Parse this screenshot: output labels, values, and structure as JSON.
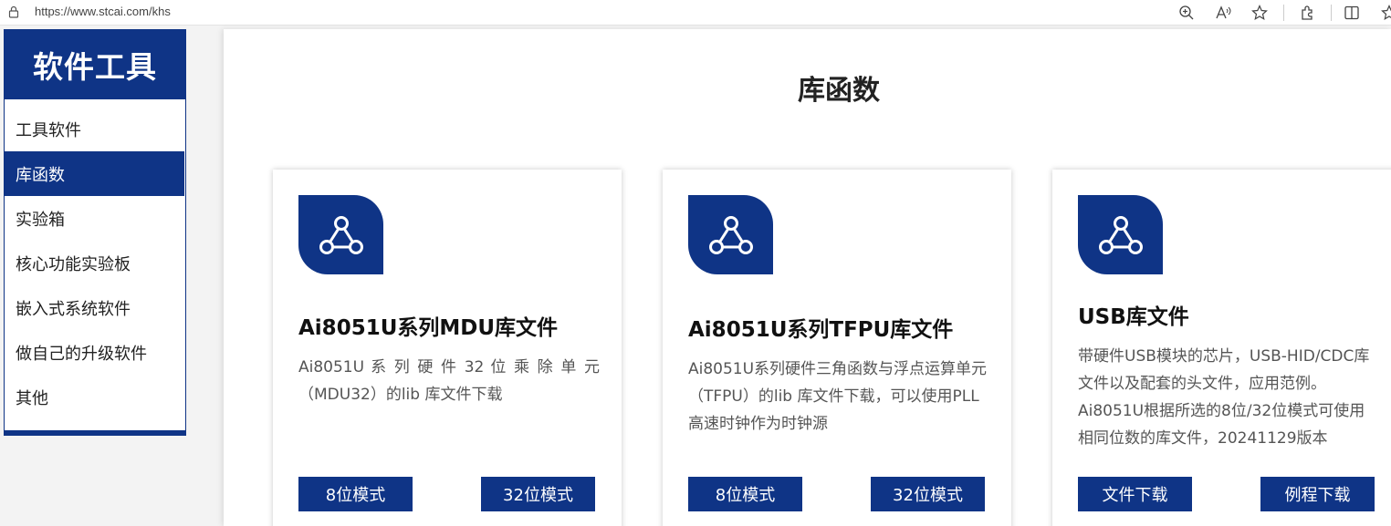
{
  "browser": {
    "url": "https://www.stcai.com/khs"
  },
  "sidebar": {
    "title": "软件工具",
    "items": [
      {
        "label": "工具软件",
        "active": false
      },
      {
        "label": "库函数",
        "active": true
      },
      {
        "label": "实验箱",
        "active": false
      },
      {
        "label": "核心功能实验板",
        "active": false
      },
      {
        "label": "嵌入式系统软件",
        "active": false
      },
      {
        "label": "做自己的升级软件",
        "active": false
      },
      {
        "label": "其他",
        "active": false
      }
    ]
  },
  "main": {
    "title": "库函数",
    "cards": [
      {
        "icon": "share-nodes-icon",
        "title": "Ai8051U系列MDU库文件",
        "desc_line1": "Ai8051U 系 列 硬 件 32 位 乘 除 单 元",
        "desc_line2": "（MDU32）的lib 库文件下载",
        "buttons": [
          "8位模式",
          "32位模式"
        ]
      },
      {
        "icon": "share-nodes-icon",
        "title": "Ai8051U系列TFPU库文件",
        "desc": "Ai8051U系列硬件三角函数与浮点运算单元（TFPU）的lib 库文件下载，可以使用PLL高速时钟作为时钟源",
        "buttons": [
          "8位模式",
          "32位模式"
        ]
      },
      {
        "icon": "share-nodes-icon",
        "title": "USB库文件",
        "desc": "带硬件USB模块的芯片，USB-HID/CDC库文件以及配套的头文件，应用范例。Ai8051U根据所选的8位/32位模式可使用相同位数的库文件，20241129版本",
        "buttons": [
          "文件下载",
          "例程下载"
        ]
      }
    ]
  },
  "colors": {
    "brand": "#0f3486"
  }
}
